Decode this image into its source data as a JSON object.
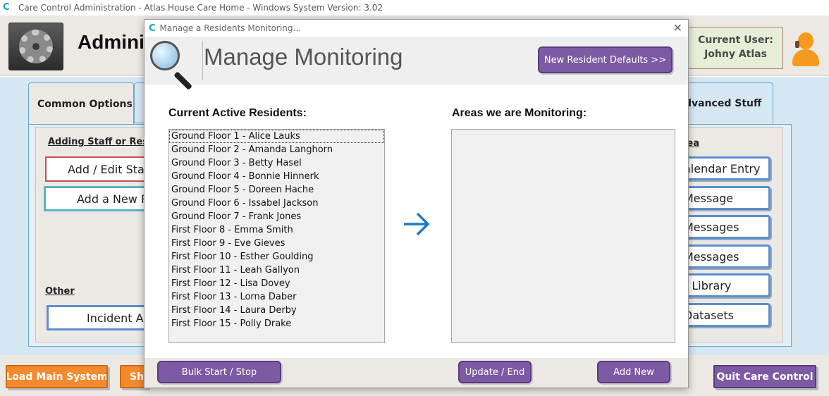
{
  "window": {
    "title": "Care Control Administration - Atlas House Care Home - Windows System Version: 3.02",
    "logo_glyph": "C"
  },
  "header": {
    "app_title": "Admini",
    "current_user_label": "Current User:",
    "current_user_name": "Johny Atlas"
  },
  "tabs": {
    "common": "Common Options",
    "advanced": "dvanced Stuff"
  },
  "left_panel": {
    "section_staff": "Adding Staff or Resi",
    "btn_add_staff": "Add / Edit Staf",
    "btn_add_resident": "Add a New R",
    "section_other": "Other",
    "btn_incident": "Incident Ar"
  },
  "right_panel": {
    "section_label": "rea",
    "buttons": [
      "alendar Entry",
      "Message",
      "Messages",
      "Messages",
      "t Library",
      "Datasets"
    ]
  },
  "footer": {
    "load_main": "Load Main System",
    "show": "Sho",
    "quit": "Quit Care Control"
  },
  "dialog": {
    "title": "Manage a Residents Monitoring...",
    "close_glyph": "✕",
    "heading": "Manage Monitoring",
    "new_defaults_btn": "New Resident Defaults >>",
    "residents_label": "Current Active Residents:",
    "areas_label": "Areas we are Monitoring:",
    "arrow_glyph": "→",
    "residents": [
      "Ground Floor 1 - Alice Lauks",
      "Ground Floor 2 - Amanda Langhorn",
      "Ground Floor 3 - Betty Hasel",
      "Ground Floor 4 - Bonnie Hinnerk",
      "Ground Floor 5 - Doreen Hache",
      "Ground Floor 6 - Issabel Jackson",
      "Ground Floor 7 - Frank Jones",
      "First Floor 8 - Emma Smith",
      "First Floor 9 - Eve Gieves",
      "First Floor 10 - Esther Goulding",
      "First Floor 11 - Leah Gallyon",
      "First Floor 12 - Lisa Dovey",
      "First Floor 13 - Lorna Daber",
      "First Floor 14 - Laura Derby",
      "First Floor 15 - Polly Drake"
    ],
    "bulk_btn": "Bulk Start / Stop",
    "update_btn": "Update / End",
    "add_btn": "Add New"
  }
}
